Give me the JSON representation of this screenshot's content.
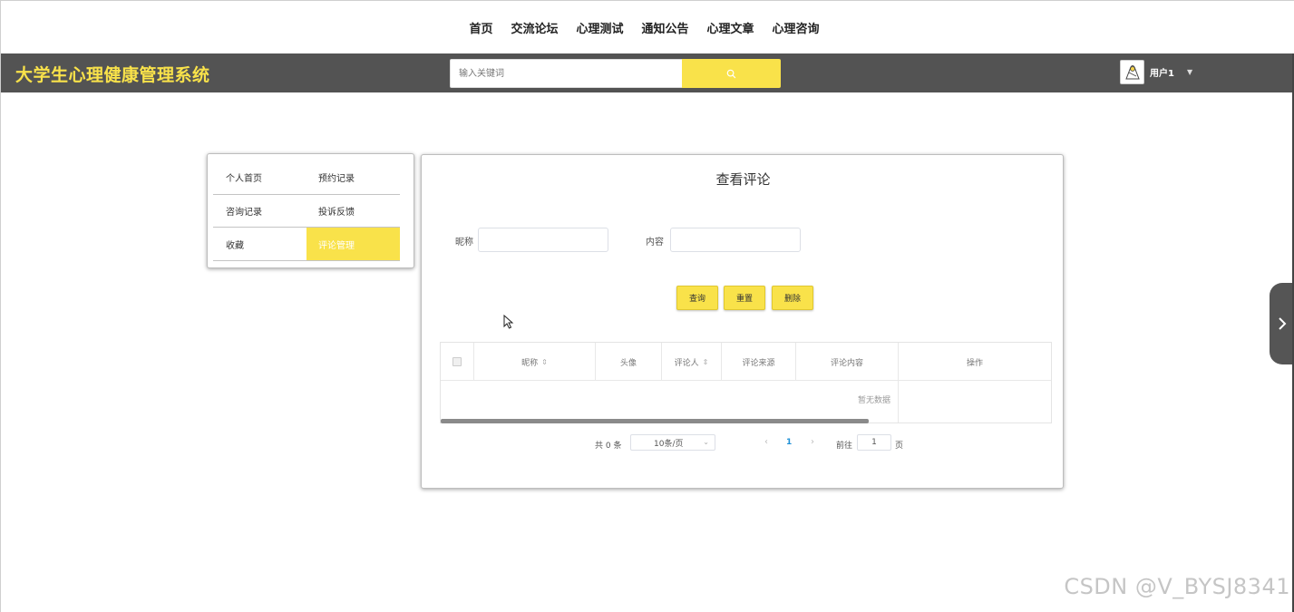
{
  "topnav": {
    "items": [
      "首页",
      "交流论坛",
      "心理测试",
      "通知公告",
      "心理文章",
      "心理咨询"
    ]
  },
  "header": {
    "site_title": "大学生心理健康管理系统",
    "search_placeholder": "输入关键词",
    "search_icon": "search-icon",
    "user_name": "用户1",
    "accent_color": "#f9e24a",
    "bar_color": "#535353"
  },
  "side_menu": {
    "items": [
      {
        "label": "个人首页",
        "active": false
      },
      {
        "label": "预约记录",
        "active": false
      },
      {
        "label": "咨询记录",
        "active": false
      },
      {
        "label": "投诉反馈",
        "active": false
      },
      {
        "label": "收藏",
        "active": false
      },
      {
        "label": "评论管理",
        "active": true
      }
    ]
  },
  "main": {
    "title": "查看评论",
    "filters": {
      "nickname_label": "昵称",
      "nickname_value": "",
      "content_label": "内容",
      "content_value": ""
    },
    "buttons": {
      "query": "查询",
      "reset": "重置",
      "delete": "删除"
    },
    "table": {
      "columns": [
        "昵称",
        "头像",
        "评论人",
        "评论来源",
        "评论内容",
        "操作"
      ],
      "rows": [],
      "empty_text": "暂无数据"
    },
    "pagination": {
      "total_text": "共 0 条",
      "page_size": "10条/页",
      "current_page": "1",
      "goto_label": "前往",
      "goto_value": "1",
      "page_suffix": "页"
    }
  },
  "watermark": "CSDN @V_BYSJ8341"
}
